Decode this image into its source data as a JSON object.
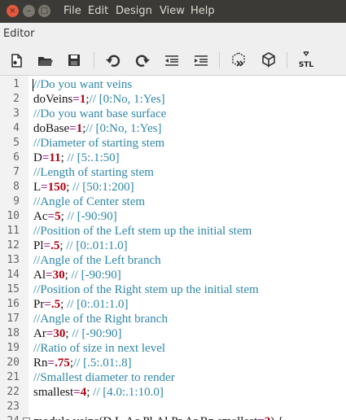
{
  "window_buttons": {
    "close": "×",
    "minimize": "–",
    "maximize": "□"
  },
  "menu": [
    "File",
    "Edit",
    "Design",
    "View",
    "Help"
  ],
  "panel_title": "Editor",
  "toolbar": {
    "icons": [
      "new-file-icon",
      "open-folder-icon",
      "save-icon",
      "undo-icon",
      "redo-icon",
      "unindent-icon",
      "indent-icon",
      "preview-icon",
      "render-icon",
      "export-stl-icon"
    ],
    "stl_label": "STL"
  },
  "colors": {
    "comment": "#2f87a8",
    "operator": "#a0318f",
    "number": "#b00010",
    "menubar": "#3b3a36"
  },
  "code_lines": [
    {
      "n": "1",
      "text": "//Do you want veins"
    },
    {
      "n": "2",
      "text": "doVeins=1;// [0:No, 1:Yes]"
    },
    {
      "n": "3",
      "text": "//Do you want base surface"
    },
    {
      "n": "4",
      "text": "doBase=1;// [0:No, 1:Yes]"
    },
    {
      "n": "5",
      "text": "//Diameter of starting stem"
    },
    {
      "n": "6",
      "text": "D=11; // [5:.1:50]"
    },
    {
      "n": "7",
      "text": "//Length of starting stem"
    },
    {
      "n": "8",
      "text": "L=150; // [50:1:200]"
    },
    {
      "n": "9",
      "text": "//Angle of Center stem"
    },
    {
      "n": "10",
      "text": "Ac=5; // [-90:90]"
    },
    {
      "n": "11",
      "text": "//Position of the Left stem up the initial stem"
    },
    {
      "n": "12",
      "text": "Pl=.5; // [0:.01:1.0]"
    },
    {
      "n": "13",
      "text": "//Angle of the Left branch"
    },
    {
      "n": "14",
      "text": "Al=30; // [-90:90]"
    },
    {
      "n": "15",
      "text": "//Position of the Right stem up the initial stem"
    },
    {
      "n": "16",
      "text": "Pr=.5; // [0:.01:1.0]"
    },
    {
      "n": "17",
      "text": "//Angle of the Right branch"
    },
    {
      "n": "18",
      "text": "Ar=30; // [-90:90]"
    },
    {
      "n": "19",
      "text": "//Ratio of size in next level"
    },
    {
      "n": "20",
      "text": "Rn=.75;// [.5:.01:.8]"
    },
    {
      "n": "21",
      "text": "//Smallest diameter to render"
    },
    {
      "n": "22",
      "text": "smallest=4; // [4.0:.1:10.0]"
    },
    {
      "n": "23",
      "text": ""
    },
    {
      "n": "24",
      "text": "module veins(D,L,Ac,Pl,Al,Pr,Ar,Rn,smallest=3) {"
    }
  ]
}
